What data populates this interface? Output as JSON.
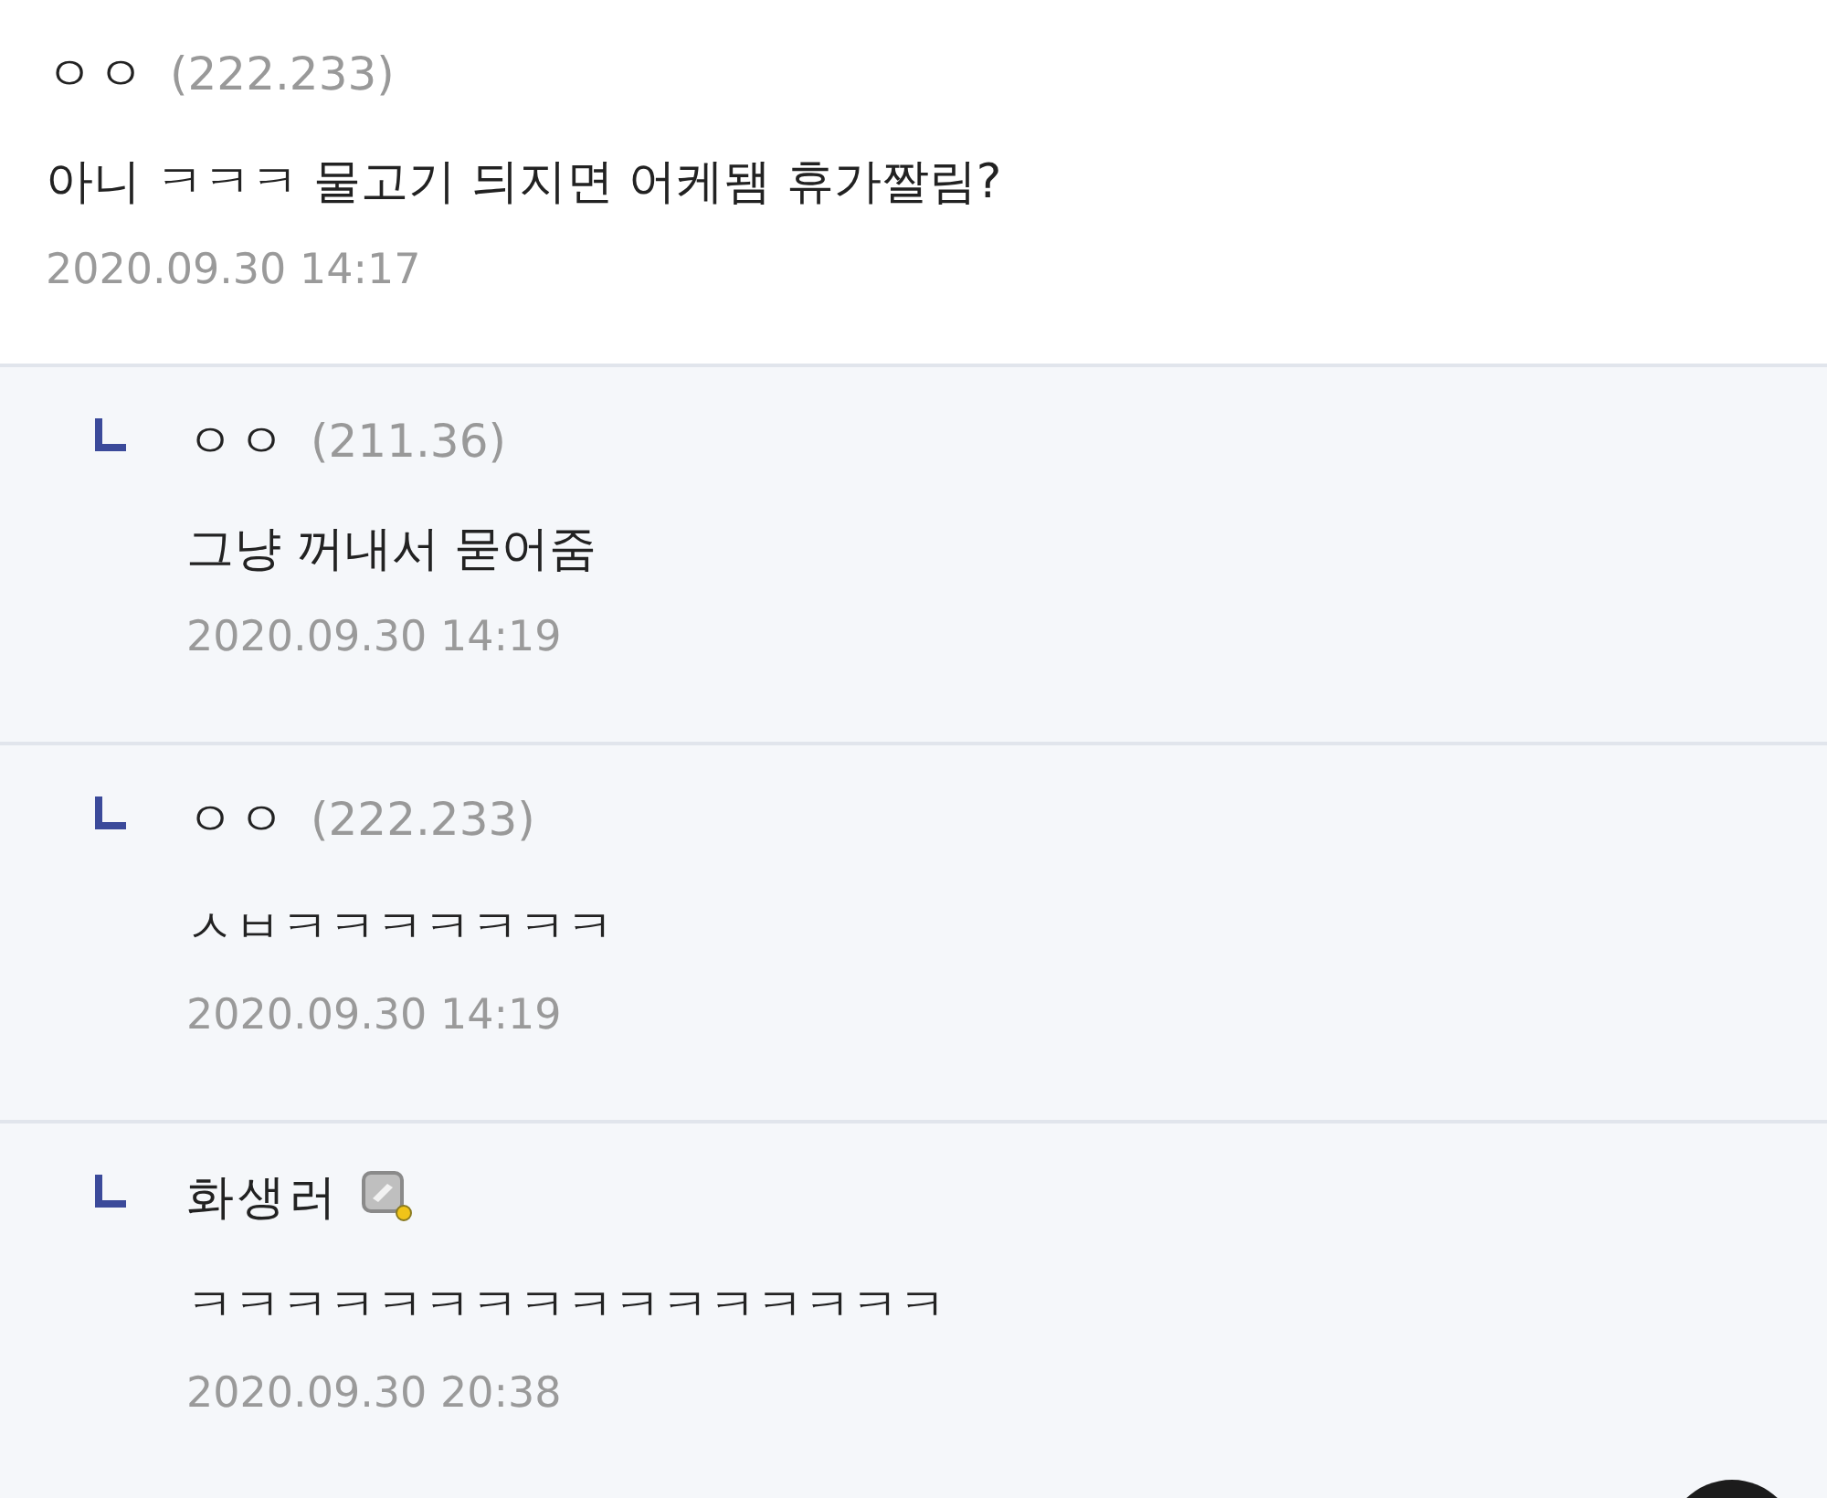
{
  "comments": [
    {
      "kind": "comment",
      "author": "ㅇㅇ",
      "ip": "(222.233)",
      "member_badge": false,
      "text": "아니 ㅋㅋㅋ 물고기 듸지면 어케됌 휴가짤림?",
      "date": "2020.09.30 14:17"
    },
    {
      "kind": "reply",
      "author": "ㅇㅇ",
      "ip": "(211.36)",
      "member_badge": false,
      "text": "그냥 꺼내서 묻어줌",
      "date": "2020.09.30 14:19"
    },
    {
      "kind": "reply",
      "author": "ㅇㅇ",
      "ip": "(222.233)",
      "member_badge": false,
      "text": "ㅅㅂㅋㅋㅋㅋㅋㅋㅋ",
      "date": "2020.09.30 14:19"
    },
    {
      "kind": "reply",
      "author": "화생러",
      "member_badge": true,
      "text": "ㅋㅋㅋㅋㅋㅋㅋㅋㅋㅋㅋㅋㅋㅋㅋㅋ",
      "date": "2020.09.30 20:38"
    }
  ]
}
